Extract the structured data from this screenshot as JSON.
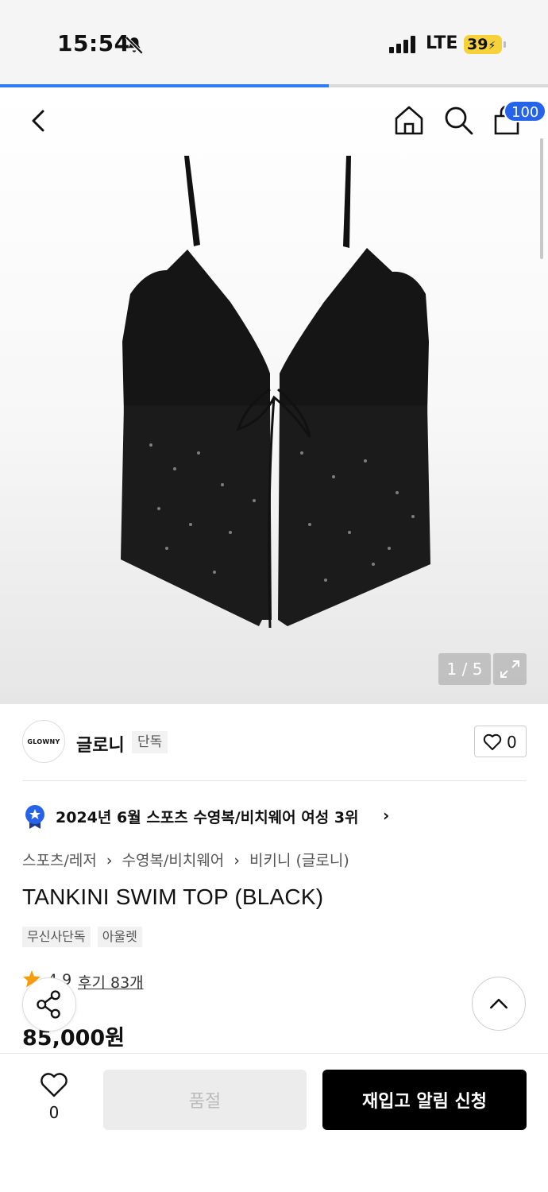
{
  "status_bar": {
    "time": "15:54",
    "network": "LTE",
    "battery": "39"
  },
  "page_progress": 0.6,
  "header": {
    "cart_count": "100"
  },
  "gallery": {
    "counter": "1 / 5"
  },
  "brand": {
    "logo_text": "GLOWNY",
    "name": "글로니",
    "tag": "단독",
    "like_count": "0"
  },
  "ranking": {
    "text": "2024년 6월 스포츠 수영복/비치웨어 여성 3위"
  },
  "breadcrumb": [
    "스포츠/레저",
    "수영복/비치웨어",
    "비키니 (글로니)"
  ],
  "product": {
    "title": "TANKINI SWIM TOP (BLACK)",
    "tags": [
      "무신사단독",
      "아울렛"
    ],
    "rating": "4.9",
    "reviews": "후기 83개",
    "price": "85,000원"
  },
  "bottom_bar": {
    "like_count": "0",
    "soldout_label": "품절",
    "restock_label": "재입고 알림 신청"
  },
  "colors": {
    "accent": "#2563eb",
    "progress": "#2e7cf6",
    "battery": "#f5d23c",
    "star": "#f59e0b",
    "medal": "#2563eb"
  }
}
